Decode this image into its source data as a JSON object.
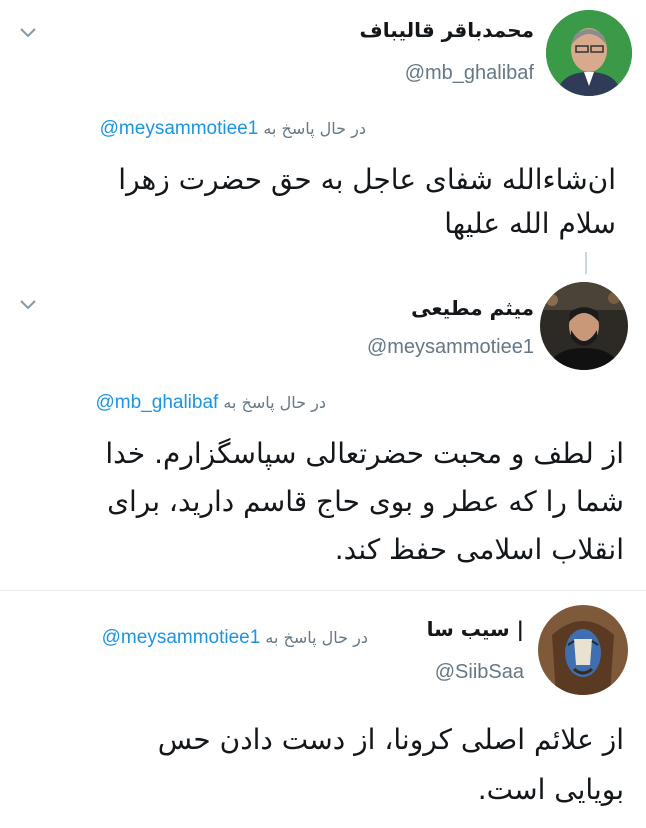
{
  "tweets": [
    {
      "name": "محمدباقر قالیباف",
      "handle": "@mb_ghalibaf",
      "reply_prefix": "در حال پاسخ به",
      "reply_to": "@meysammotiee1",
      "text_lines": [
        "ان‌شاءالله شفای عاجل به حق حضرت زهرا",
        "سلام الله علیها"
      ]
    },
    {
      "name": "میثم مطیعی",
      "handle": "@meysammotiee1",
      "reply_prefix": "در حال پاسخ به",
      "reply_to": "@mb_ghalibaf",
      "text_lines": [
        "از لطف و محبت حضرتعالی سپاسگزارم. خدا",
        "شما را که عطر و بوی حاج قاسم دارید، برای",
        "انقلاب اسلامی حفظ کند."
      ]
    },
    {
      "name": "| سیب سا",
      "handle": "@SiibSaa",
      "reply_prefix": "در حال پاسخ به",
      "reply_to": "@meysammotiee1",
      "text_lines": [
        "از علائم اصلی کرونا، از دست دادن حس",
        "بویایی است."
      ]
    }
  ],
  "icons": {
    "menu": "chevron-down-icon",
    "avatar": "avatar"
  },
  "colors": {
    "link": "#1b95e0",
    "muted": "#657786",
    "text": "#14171a",
    "divider": "#e6ecf0"
  }
}
